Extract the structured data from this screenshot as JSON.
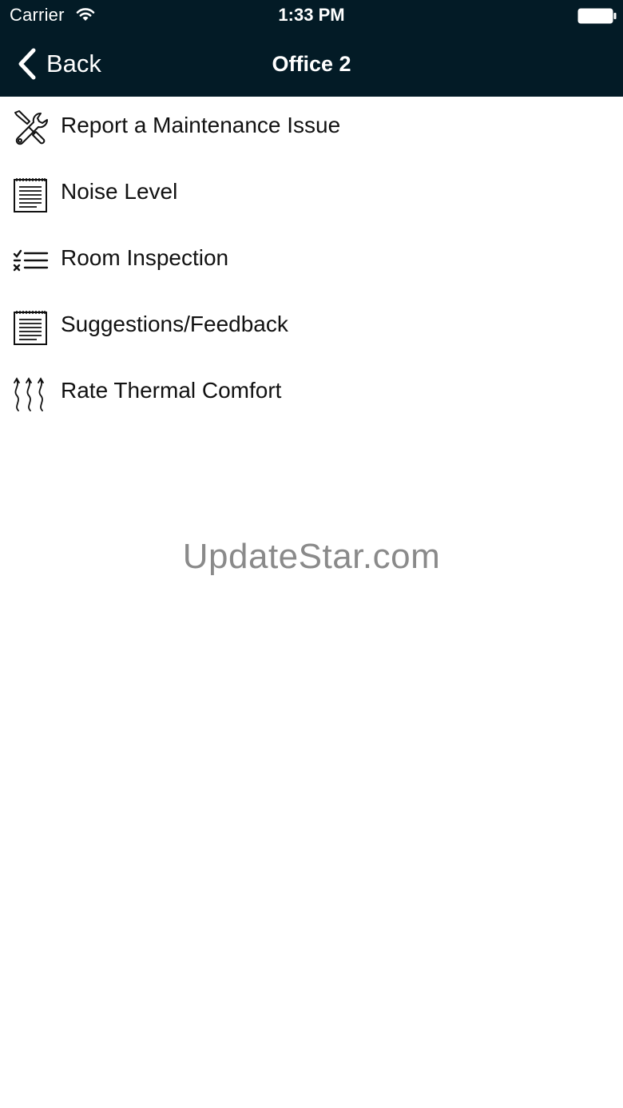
{
  "status_bar": {
    "carrier": "Carrier",
    "time": "1:33 PM",
    "wifi_icon": "wifi-icon",
    "battery_icon": "battery-icon"
  },
  "nav": {
    "back_label": "Back",
    "title": "Office 2",
    "background_color": "#031b26"
  },
  "menu": {
    "items": [
      {
        "label": "Report a Maintenance Issue",
        "icon": "tools-icon"
      },
      {
        "label": "Noise Level",
        "icon": "notepad-icon"
      },
      {
        "label": "Room Inspection",
        "icon": "checklist-icon"
      },
      {
        "label": "Suggestions/Feedback",
        "icon": "notepad-icon"
      },
      {
        "label": "Rate Thermal Comfort",
        "icon": "heat-waves-icon"
      }
    ]
  },
  "watermark": "UpdateStar.com"
}
